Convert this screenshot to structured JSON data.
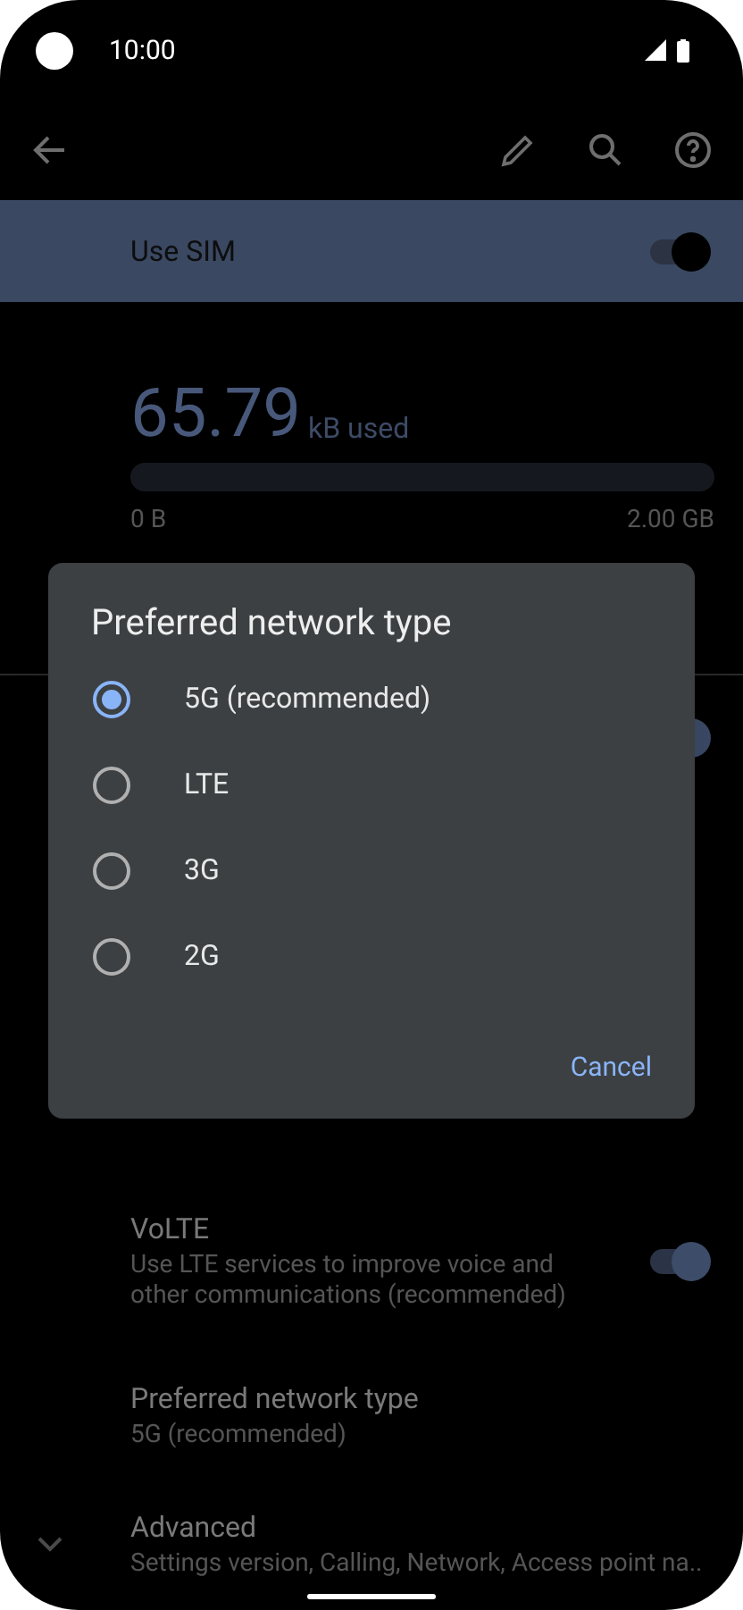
{
  "status_bar": {
    "time": "10:00"
  },
  "sim_toggle": {
    "label": "Use SIM",
    "on": true
  },
  "usage": {
    "amount": "65.79",
    "unit": "kB used",
    "min": "0 B",
    "max": "2.00 GB"
  },
  "hidden_toggle": {
    "on": true
  },
  "settings": [
    {
      "kind": "toggle",
      "title": "VoLTE",
      "subtitle": "Use LTE services to improve voice and other communications (recommended)",
      "on": true
    },
    {
      "kind": "plain",
      "title": "Preferred network type",
      "subtitle": "5G (recommended)"
    },
    {
      "kind": "expand",
      "title": "Advanced",
      "subtitle": "Settings version, Calling, Network, Access point na.."
    }
  ],
  "dialog": {
    "title": "Preferred network type",
    "options": [
      {
        "label": "5G (recommended)",
        "selected": true
      },
      {
        "label": "LTE",
        "selected": false
      },
      {
        "label": "3G",
        "selected": false
      },
      {
        "label": "2G",
        "selected": false
      }
    ],
    "buttons": [
      "Cancel"
    ]
  }
}
